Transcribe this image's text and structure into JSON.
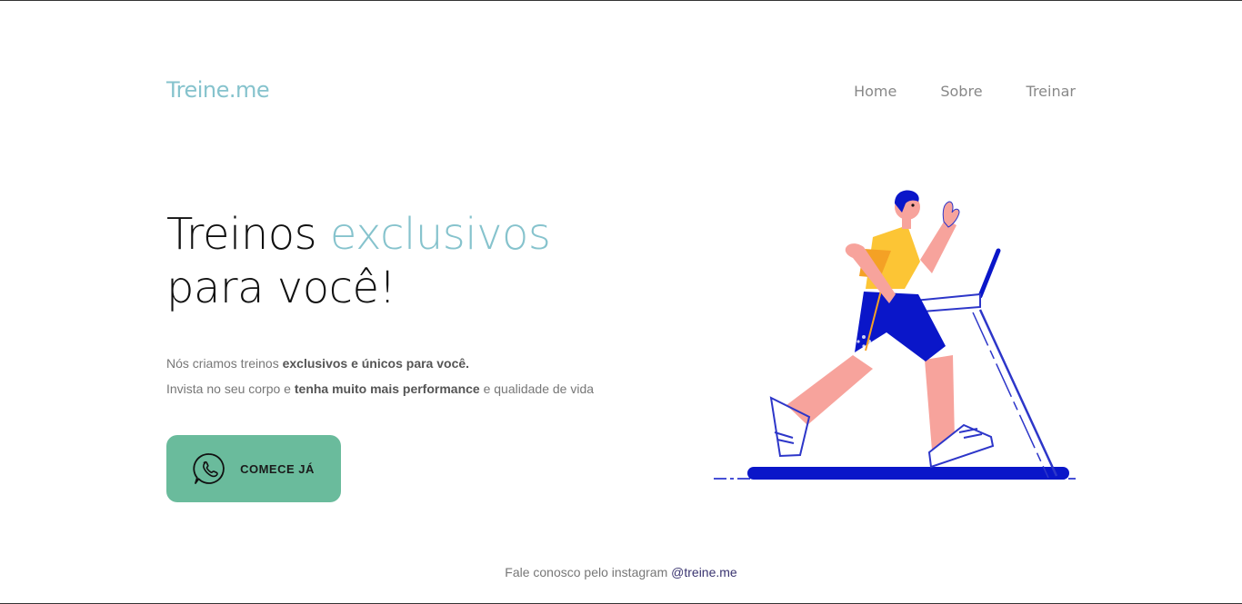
{
  "header": {
    "logo": "Treine.me",
    "nav": [
      {
        "label": "Home"
      },
      {
        "label": "Sobre"
      },
      {
        "label": "Treinar"
      }
    ]
  },
  "hero": {
    "title_prefix": "Treinos ",
    "title_accent": "exclusivos",
    "title_line2": "para você!",
    "line1_a": "Nós criamos treinos ",
    "line1_b": "exclusivos e únicos para você.",
    "line2_a": "Invista no seu corpo e ",
    "line2_b": "tenha muito mais performance",
    "line2_c": " e qualidade de vida",
    "cta_label": "COMECE JÁ",
    "cta_icon": "whatsapp-icon"
  },
  "footer": {
    "text": "Fale conosco pelo instagram ",
    "handle": "@treine.me"
  },
  "colors": {
    "accent": "#86c3cd",
    "button": "#6abb9c",
    "illustration_blue": "#0a16c9",
    "illustration_skin": "#f7a39c",
    "illustration_shirt": "#fcc535"
  }
}
